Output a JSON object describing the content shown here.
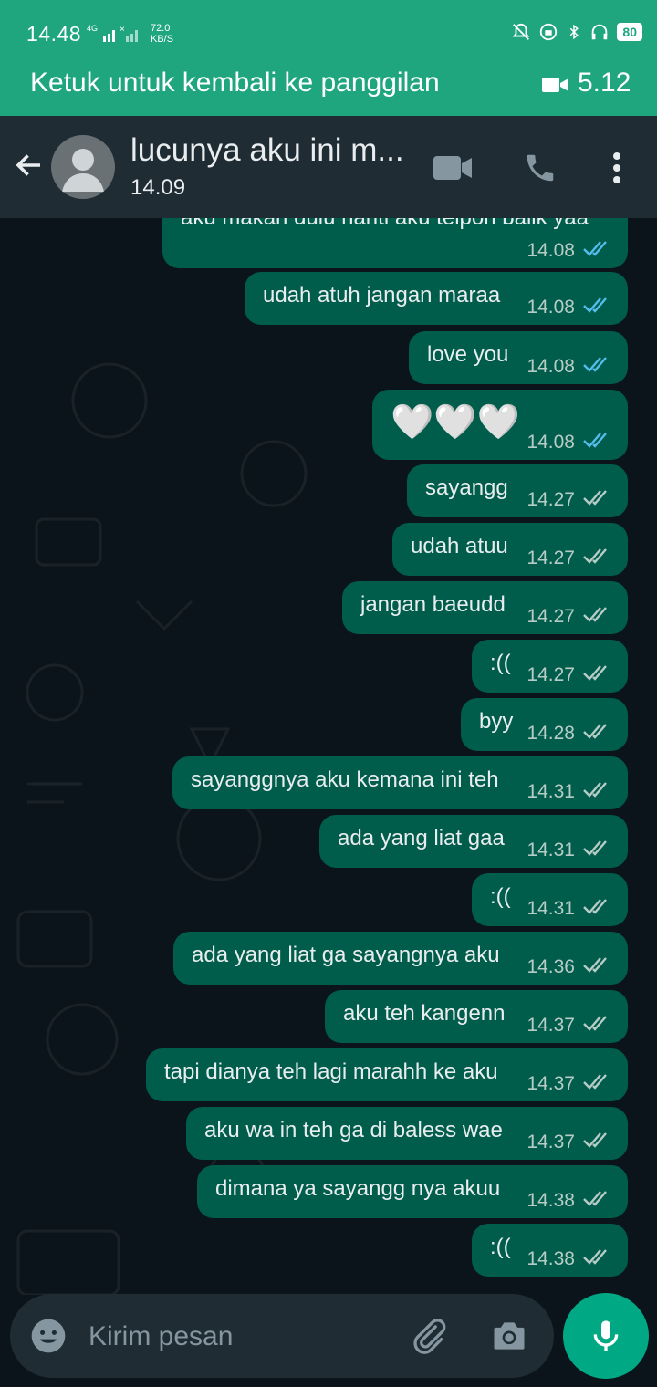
{
  "status_bar": {
    "time": "14.48",
    "network": "4G",
    "speed_value": "72.0",
    "speed_unit": "KB/S",
    "battery": "80",
    "icons": [
      "mute-bell-icon",
      "dnd-icon",
      "bluetooth-icon",
      "headphones-icon"
    ]
  },
  "call_banner": {
    "text": "Ketuk untuk kembali ke panggilan",
    "duration": "5.12",
    "icon": "video-camera-icon"
  },
  "header": {
    "title": "lucunya aku ini m...",
    "subtitle": "14.09",
    "icons": [
      "back-arrow-icon",
      "avatar",
      "video-call-icon",
      "phone-icon",
      "more-vert-icon"
    ]
  },
  "messages": [
    {
      "text": "aku makan dulu nanti aku telpon balik yaa",
      "time": "14.08",
      "read": true
    },
    {
      "text": "udah atuh jangan maraa",
      "time": "14.08",
      "read": true
    },
    {
      "text": "love you",
      "time": "14.08",
      "read": true
    },
    {
      "text": "🤍🤍🤍",
      "time": "14.08",
      "read": true
    },
    {
      "text": "sayangg",
      "time": "14.27",
      "read": false
    },
    {
      "text": "udah atuu",
      "time": "14.27",
      "read": false
    },
    {
      "text": "jangan baeudd",
      "time": "14.27",
      "read": false
    },
    {
      "text": ":((",
      "time": "14.27",
      "read": false
    },
    {
      "text": "byy",
      "time": "14.28",
      "read": false
    },
    {
      "text": "sayanggnya aku kemana ini teh",
      "time": "14.31",
      "read": false
    },
    {
      "text": "ada yang liat gaa",
      "time": "14.31",
      "read": false
    },
    {
      "text": ":((",
      "time": "14.31",
      "read": false
    },
    {
      "text": "ada yang liat ga sayangnya aku",
      "time": "14.36",
      "read": false
    },
    {
      "text": "aku teh kangenn",
      "time": "14.37",
      "read": false
    },
    {
      "text": "tapi dianya teh lagi marahh ke aku",
      "time": "14.37",
      "read": false
    },
    {
      "text": "aku wa in teh ga di baless wae",
      "time": "14.37",
      "read": false
    },
    {
      "text": "dimana ya sayangg nya akuu",
      "time": "14.38",
      "read": false
    },
    {
      "text": ":((",
      "time": "14.38",
      "read": false
    }
  ],
  "composer": {
    "placeholder": "Kirim pesan",
    "icons": [
      "emoji-icon",
      "attach-icon",
      "camera-icon",
      "mic-icon"
    ]
  },
  "colors": {
    "banner": "#1fa67f",
    "header": "#1f2c33",
    "chat_bg": "#0b141a",
    "bubble_out": "#005c4b",
    "read_tick": "#53bdeb",
    "unread_tick": "#b7ccc6",
    "accent": "#00a884"
  }
}
